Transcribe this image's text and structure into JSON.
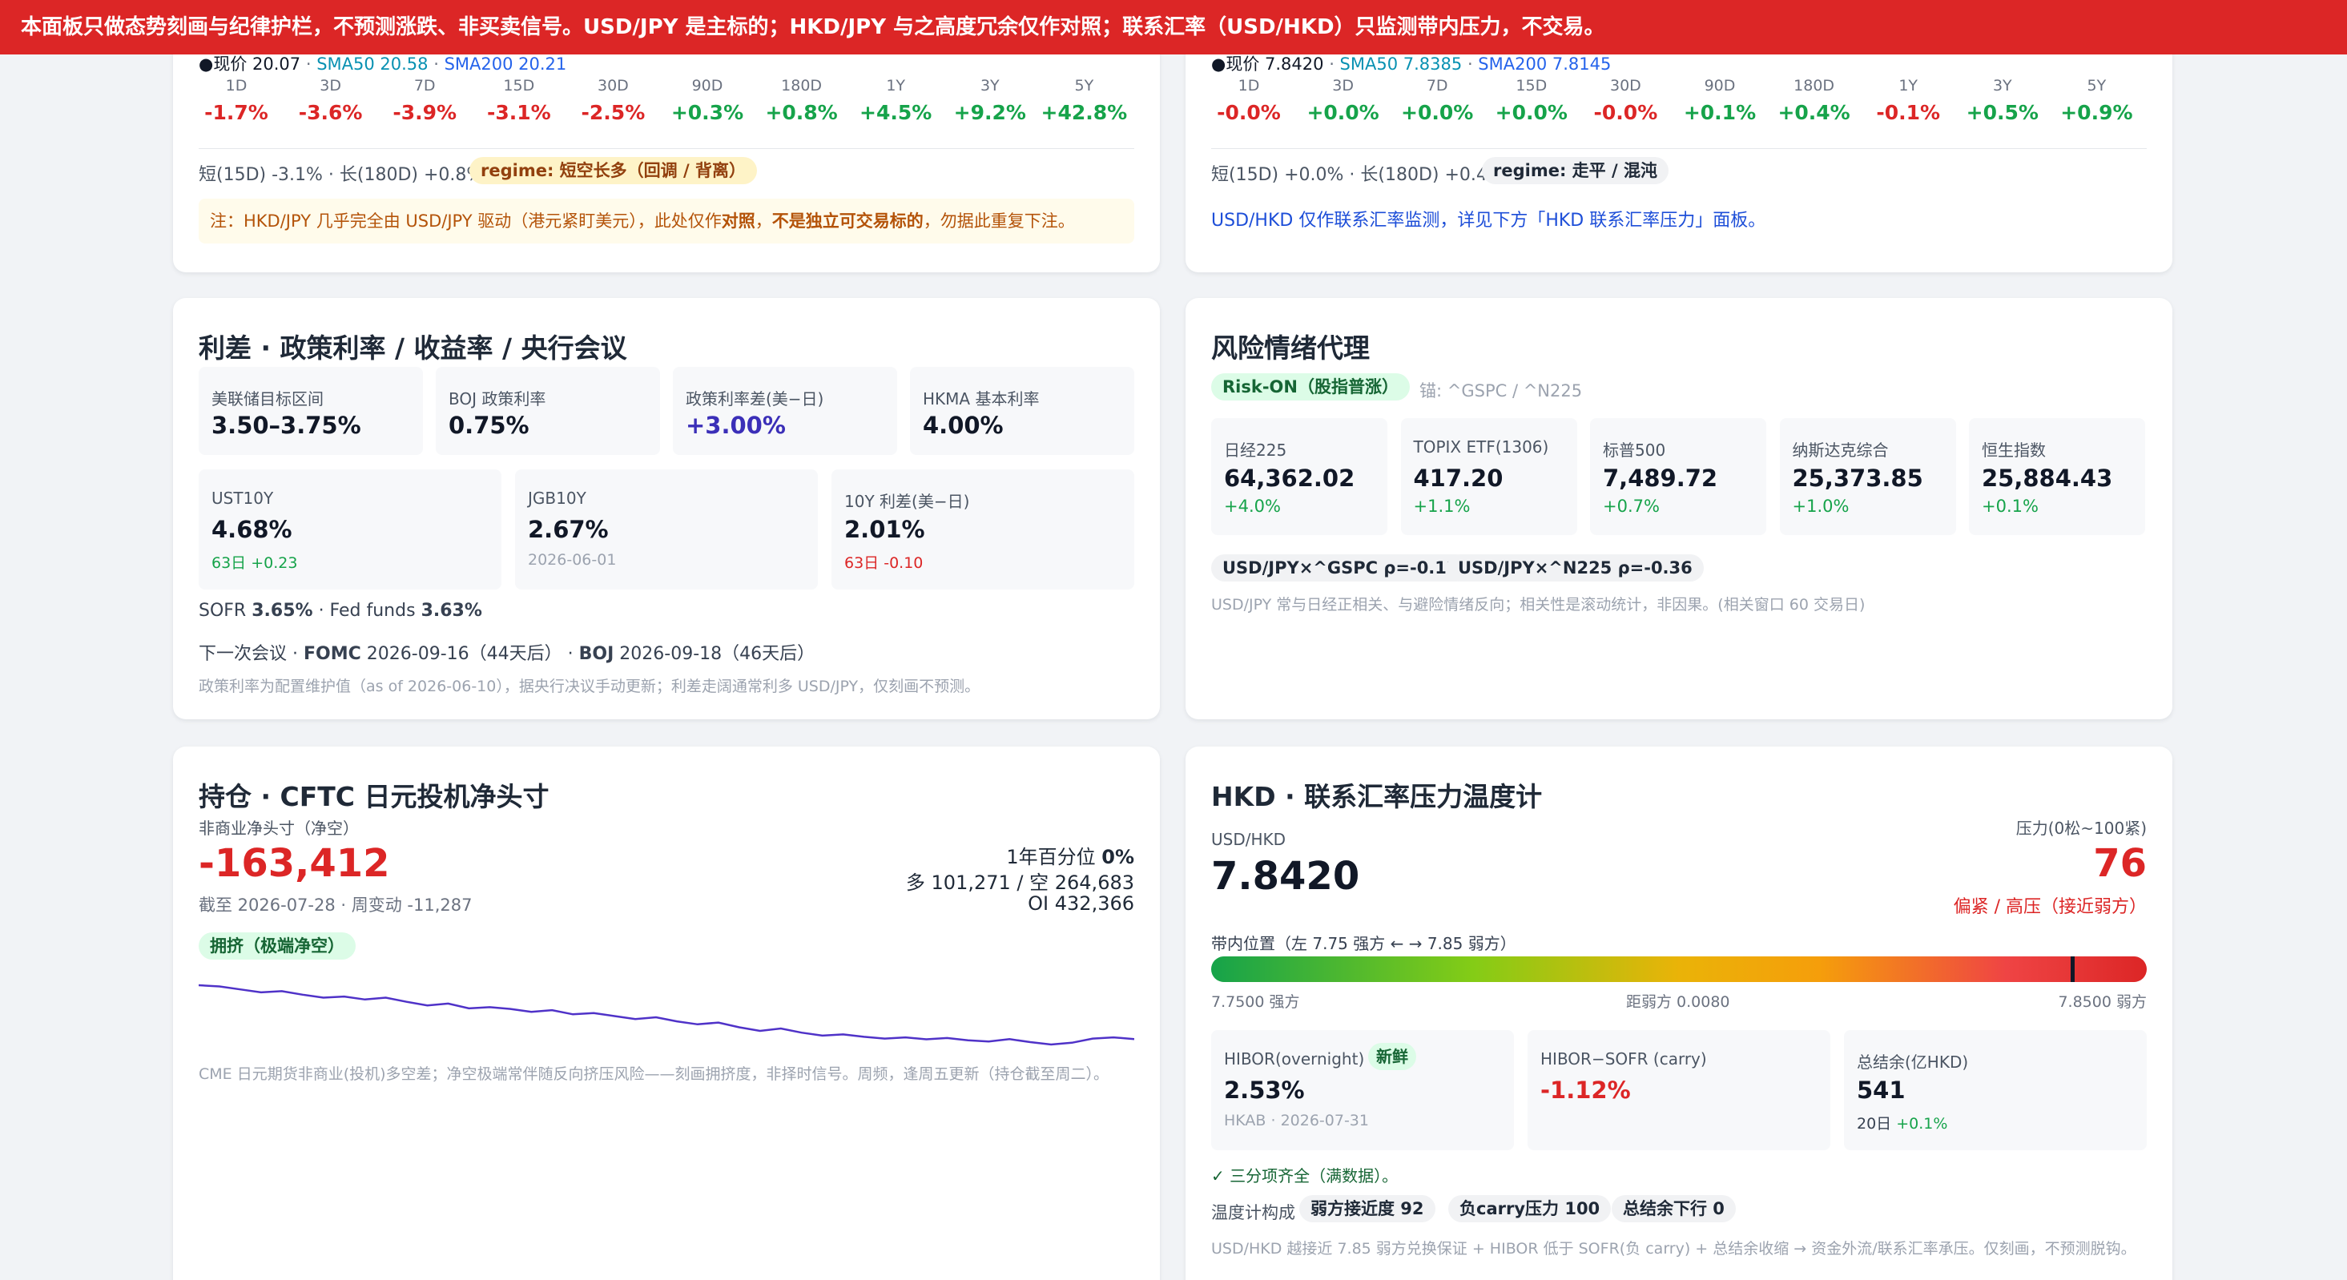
{
  "banner": "本面板只做态势刻画与纪律护栏，不预测涨跌、非买卖信号。USD/JPY 是主标的；HKD/JPY 与之高度冗余仅作对照；联系汇率（USD/HKD）只监测带内压力，不交易。",
  "colors": {
    "accent_red": "#dc2626",
    "green": "#16a34a",
    "purple": "#4f32c8",
    "sma50": "#0891b2",
    "sma200": "#2563eb"
  },
  "hkdjpy": {
    "price_line": {
      "prefix": "●现价",
      "price": "20.07",
      "sma50_label": "SMA50 20.58",
      "sma200_label": "SMA200 20.21"
    },
    "periods": [
      {
        "label": "1D",
        "value": "-1.7%",
        "dir": "down"
      },
      {
        "label": "3D",
        "value": "-3.6%",
        "dir": "down"
      },
      {
        "label": "7D",
        "value": "-3.9%",
        "dir": "down"
      },
      {
        "label": "15D",
        "value": "-3.1%",
        "dir": "down"
      },
      {
        "label": "30D",
        "value": "-2.5%",
        "dir": "down"
      },
      {
        "label": "90D",
        "value": "+0.3%",
        "dir": "up"
      },
      {
        "label": "180D",
        "value": "+0.8%",
        "dir": "up"
      },
      {
        "label": "1Y",
        "value": "+4.5%",
        "dir": "up"
      },
      {
        "label": "3Y",
        "value": "+9.2%",
        "dir": "up"
      },
      {
        "label": "5Y",
        "value": "+42.8%",
        "dir": "up"
      }
    ],
    "trend_text": "短(15D) -3.1% · 长(180D) +0.8%",
    "regime": "regime: 短空长多（回调 / 背离）",
    "note_a": "注：HKD/JPY 几乎完全由 USD/JPY 驱动（港元紧盯美元），此处仅作",
    "note_b": "对照",
    "note_c": "，",
    "note_d": "不是独立可交易标的",
    "note_e": "，勿据此重复下注。"
  },
  "usdhkd": {
    "price_line": {
      "prefix": "●现价",
      "price": "7.8420",
      "sma50_label": "SMA50 7.8385",
      "sma200_label": "SMA200 7.8145"
    },
    "periods": [
      {
        "label": "1D",
        "value": "-0.0%",
        "dir": "down"
      },
      {
        "label": "3D",
        "value": "+0.0%",
        "dir": "up"
      },
      {
        "label": "7D",
        "value": "+0.0%",
        "dir": "up"
      },
      {
        "label": "15D",
        "value": "+0.0%",
        "dir": "up"
      },
      {
        "label": "30D",
        "value": "-0.0%",
        "dir": "down"
      },
      {
        "label": "90D",
        "value": "+0.1%",
        "dir": "up"
      },
      {
        "label": "180D",
        "value": "+0.4%",
        "dir": "up"
      },
      {
        "label": "1Y",
        "value": "-0.1%",
        "dir": "down"
      },
      {
        "label": "3Y",
        "value": "+0.5%",
        "dir": "up"
      },
      {
        "label": "5Y",
        "value": "+0.9%",
        "dir": "up"
      }
    ],
    "trend_text": "短(15D) +0.0% · 长(180D) +0.4%",
    "regime": "regime: 走平 / 混沌",
    "note": "USD/HKD 仅作联系汇率监测，详见下方「HKD 联系汇率压力」面板。"
  },
  "rates": {
    "title": "利差 · 政策利率 / 收益率 / 央行会议",
    "policy_tiles": [
      {
        "label": "美联储目标区间",
        "value": "3.50–3.75%"
      },
      {
        "label": "BOJ 政策利率",
        "value": "0.75%"
      },
      {
        "label": "政策利率差(美−日)",
        "value": "+3.00%"
      },
      {
        "label": "HKMA 基本利率",
        "value": "4.00%"
      }
    ],
    "yield_tiles": [
      {
        "label": "UST10Y",
        "value": "4.68%",
        "sub": "63日 +0.23"
      },
      {
        "label": "JGB10Y",
        "value": "2.67%",
        "sub": "2026-06-01"
      },
      {
        "label": "10Y 利差(美−日)",
        "value": "2.01%",
        "sub": "63日 -0.10"
      }
    ],
    "sofr_label": "SOFR",
    "sofr_value": "3.65%",
    "fed_label": "· Fed funds",
    "fed_value": "3.63%",
    "meeting_prefix": "下一次会议 ·",
    "fomc_label": "FOMC",
    "fomc_text": "2026-09-16（44天后）",
    "sep": "·",
    "boj_label": "BOJ",
    "boj_text": "2026-09-18（46天后）",
    "footnote": "政策利率为配置维护值（as of 2026-06-10），据央行决议手动更新；利差走阔通常利多 USD/JPY，仅刻画不预测。"
  },
  "risk": {
    "title": "风险情绪代理",
    "badge": "Risk-ON（股指普涨）",
    "anchor": "锚: ^GSPC / ^N225",
    "indices": [
      {
        "label": "日经225",
        "value": "64,362.02",
        "change": "+4.0%"
      },
      {
        "label": "TOPIX ETF(1306)",
        "value": "417.20",
        "change": "+1.1%"
      },
      {
        "label": "标普500",
        "value": "7,489.72",
        "change": "+0.7%"
      },
      {
        "label": "纳斯达克综合",
        "value": "25,373.85",
        "change": "+1.0%"
      },
      {
        "label": "恒生指数",
        "value": "25,884.43",
        "change": "+0.1%"
      }
    ],
    "corr1": "USD/JPY×^GSPC ρ=-0.12",
    "corr2": "USD/JPY×^N225 ρ=-0.36",
    "note": "USD/JPY 常与日经正相关、与避险情绪反向；相关性是滚动统计，非因果。(相关窗口 60 交易日)"
  },
  "cftc": {
    "title": "持仓 · CFTC 日元投机净头寸",
    "subtitle": "非商业净头寸（净空）",
    "net": "-163,412",
    "asof": "截至 2026-07-28 · 周变动 -11,287",
    "pct_label": "1年百分位",
    "pct_value": "0%",
    "long_short": "多 101,271 / 空 264,683",
    "oi": "OI 432,366",
    "badge": "拥挤（极端净空）",
    "sparkline": [
      -118000,
      -119000,
      -121500,
      -124000,
      -123000,
      -126000,
      -128500,
      -127500,
      -130000,
      -128500,
      -132000,
      -135000,
      -133500,
      -137500,
      -136500,
      -138000,
      -140500,
      -139000,
      -142500,
      -141500,
      -144000,
      -146500,
      -145000,
      -148500,
      -151000,
      -149500,
      -153500,
      -156500,
      -154500,
      -158000,
      -160500,
      -159500,
      -161500,
      -163000,
      -162000,
      -163600,
      -162500,
      -164500,
      -165500,
      -163500,
      -166000,
      -168000,
      -166500,
      -163000,
      -162000,
      -163412
    ],
    "note": "CME 日元期货非商业(投机)多空差；净空极端常伴随反向挤压风险——刻画拥挤度，非择时信号。周频，逢周五更新（持仓截至周二）。"
  },
  "hkd": {
    "title": "HKD · 联系汇率压力温度计",
    "pair_label": "USD/HKD",
    "rate": "7.8420",
    "pressure_label": "压力(0松~100紧)",
    "pressure_value": "76",
    "pressure_state": "偏紧 / 高压（接近弱方）",
    "band_label": "带内位置（左 7.75 强方 ← → 7.85 弱方）",
    "band_min": 7.75,
    "band_max": 7.85,
    "band_current": 7.842,
    "band_left": "7.7500 强方",
    "band_mid": "距弱方 0.0080",
    "band_right": "7.8500 弱方",
    "tiles": [
      {
        "label": "HIBOR(overnight)",
        "badge": "新鲜",
        "value": "2.53%",
        "sub": "HKAB · 2026-07-31"
      },
      {
        "label": "HIBOR−SOFR (carry)",
        "value": "-1.12%"
      },
      {
        "label": "总结余(亿HKD)",
        "value": "541",
        "sub_a": "20日",
        "sub_b": "+0.1%"
      }
    ],
    "check": "✓ 三分项齐全（满数据）。",
    "composition_label": "温度计构成",
    "comp": [
      "弱方接近度 92",
      "负carry压力 100",
      "总结余下行 0"
    ],
    "note": "USD/HKD 越接近 7.85 弱方兑换保证 + HIBOR 低于 SOFR(负 carry) + 总结余收缩 → 资金外流/联系汇率承压。仅刻画，不预测脱钩。"
  }
}
